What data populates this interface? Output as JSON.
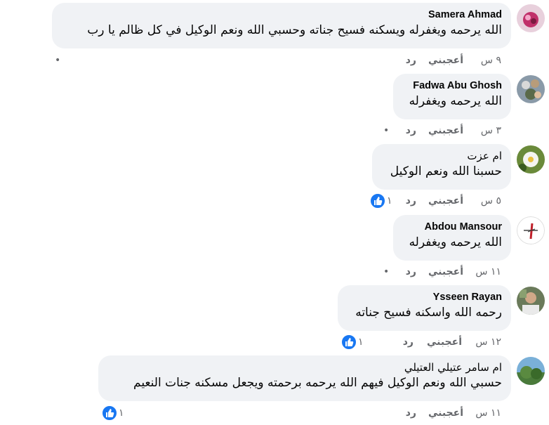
{
  "comments": [
    {
      "author": "Samera Ahmad",
      "text": "الله يرحمه ويغفرله ويسكنه فسيح جناته وحسبي الله ونعم الوكيل في كل ظالم يا رب",
      "time": "٩ س",
      "like": "أعجبني",
      "reply": "رد",
      "more": "•"
    },
    {
      "author": "Fadwa Abu Ghosh",
      "text": "الله يرحمه ويغفرله",
      "time": "٣ س",
      "like": "أعجبني",
      "reply": "رد",
      "more": "•"
    },
    {
      "author": "ام عزت",
      "text": "حسبنا الله ونعم الوكيل",
      "time": "٥ س",
      "like": "أعجبني",
      "reply": "رد",
      "reactions": "١"
    },
    {
      "author": "Abdou Mansour",
      "text": "الله يرحمه ويغفرله",
      "time": "١١ س",
      "like": "أعجبني",
      "reply": "رد",
      "more": "•"
    },
    {
      "author": "Ysseen Rayan",
      "text": "رحمه الله واسكنه فسيح جناته",
      "time": "١٢ س",
      "like": "أعجبني",
      "reply": "رد",
      "reactions": "١"
    },
    {
      "author": "ام سامر عتيلي العتيلي",
      "text": "حسبي الله ونعم الوكيل فيهم الله يرحمه برحمته ويجعل مسكنه جنات النعيم",
      "time": "١١ س",
      "like": "أعجبني",
      "reply": "رد",
      "reactions": "١"
    }
  ],
  "colors": {
    "bubble": "#f0f2f5",
    "meta": "#65676b",
    "like_blue": "#1877f2"
  },
  "icons": {
    "reaction": "thumbs-up-icon",
    "more": "dot-icon"
  }
}
